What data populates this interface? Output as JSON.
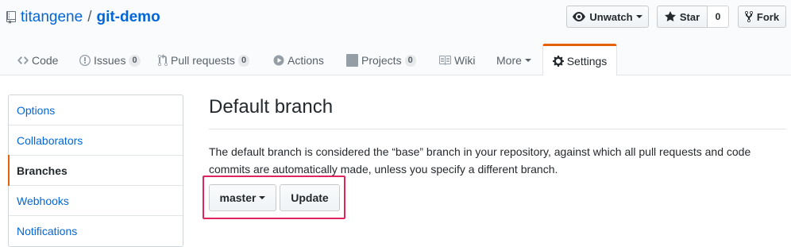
{
  "repo": {
    "owner": "titangene",
    "separator": "/",
    "name": "git-demo"
  },
  "actions": {
    "unwatch_label": "Unwatch",
    "star_label": "Star",
    "star_count": "0",
    "fork_label": "Fork"
  },
  "tabs": [
    {
      "label": "Code",
      "icon": "code-icon"
    },
    {
      "label": "Issues",
      "icon": "issue-icon",
      "count": "0"
    },
    {
      "label": "Pull requests",
      "icon": "pull-request-icon",
      "count": "0"
    },
    {
      "label": "Actions",
      "icon": "play-icon"
    },
    {
      "label": "Projects",
      "icon": "project-icon",
      "count": "0"
    },
    {
      "label": "Wiki",
      "icon": "book-icon"
    },
    {
      "label": "More",
      "icon": "chevron-down-icon"
    },
    {
      "label": "Settings",
      "icon": "gear-icon",
      "selected": true
    }
  ],
  "sidebar": {
    "items": [
      {
        "label": "Options"
      },
      {
        "label": "Collaborators"
      },
      {
        "label": "Branches",
        "selected": true
      },
      {
        "label": "Webhooks"
      },
      {
        "label": "Notifications"
      }
    ]
  },
  "main": {
    "title": "Default branch",
    "description": "The default branch is considered the “base” branch in your repository, against which all pull requests and code commits are automatically made, unless you specify a different branch.",
    "branch_select": "master",
    "update_label": "Update"
  },
  "colors": {
    "link": "#0366d6",
    "accent_tab": "#e36209",
    "highlight_box": "#e0245e"
  }
}
